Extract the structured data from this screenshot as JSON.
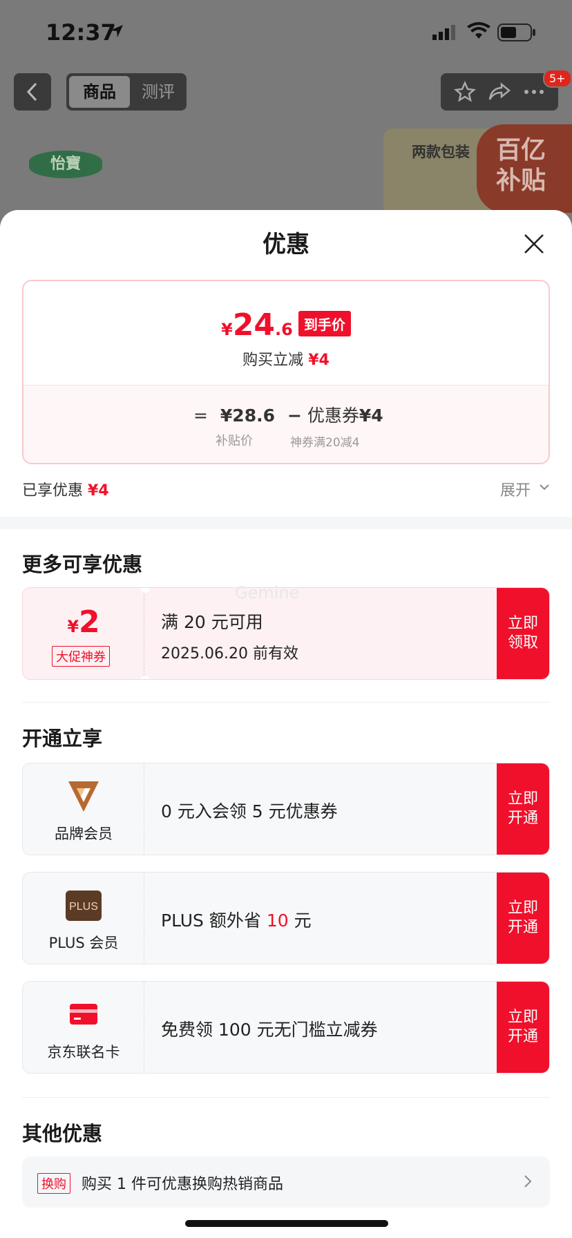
{
  "status_bar": {
    "time": "12:37"
  },
  "header": {
    "tabs": [
      {
        "label": "商品",
        "active": true
      },
      {
        "label": "测评",
        "active": false
      }
    ],
    "notification_badge": "5+"
  },
  "background": {
    "brand_logo_text": "怡寶",
    "product_thumb_text": "两款包装",
    "subsidy_badge_text": "百亿补贴"
  },
  "sheet": {
    "title": "优惠",
    "summary": {
      "price_currency": "¥",
      "price_integer": "24",
      "price_decimal": ".6",
      "price_tag": "到手价",
      "reduce_text": "购买立减",
      "reduce_amount": "¥4",
      "calc_equals": "=",
      "subsidy_price": "¥28.6",
      "calc_minus": "−",
      "coupon_label": "优惠券",
      "coupon_amount": "¥4",
      "subsidy_price_label": "补贴价",
      "coupon_desc": "神券满20减4"
    },
    "enjoyed_label": "已享优惠",
    "enjoyed_amount": "¥4",
    "expand_label": "展开",
    "more_section": {
      "title": "更多可享优惠",
      "coupon": {
        "currency": "¥",
        "amount": "2",
        "tag": "大促神券",
        "condition": "满 20 元可用",
        "expiry": "2025.06.20 前有效",
        "action": "立即领取"
      },
      "watermark": "Gemine"
    },
    "membership_section": {
      "title": "开通立享",
      "items": [
        {
          "label": "品牌会员",
          "text": "0 元入会领 5 元优惠券",
          "action": "立即开通",
          "icon": "brand-v-icon"
        },
        {
          "label": "PLUS 会员",
          "text_prefix": "PLUS 额外省 ",
          "text_highlight": "10",
          "text_suffix": " 元",
          "action": "立即开通",
          "icon": "plus-badge-icon",
          "icon_text": "PLUS"
        },
        {
          "label": "京东联名卡",
          "text": "免费领 100 元无门槛立减券",
          "action": "立即开通",
          "icon": "credit-card-icon"
        }
      ]
    },
    "other_section": {
      "title": "其他优惠",
      "tag": "换购",
      "text": "购买 1 件可优惠换购热销商品"
    }
  },
  "colors": {
    "accent": "#f0102b",
    "card_bg_red": "#fdf1f3",
    "card_bg_gray": "#f7f8fa"
  }
}
